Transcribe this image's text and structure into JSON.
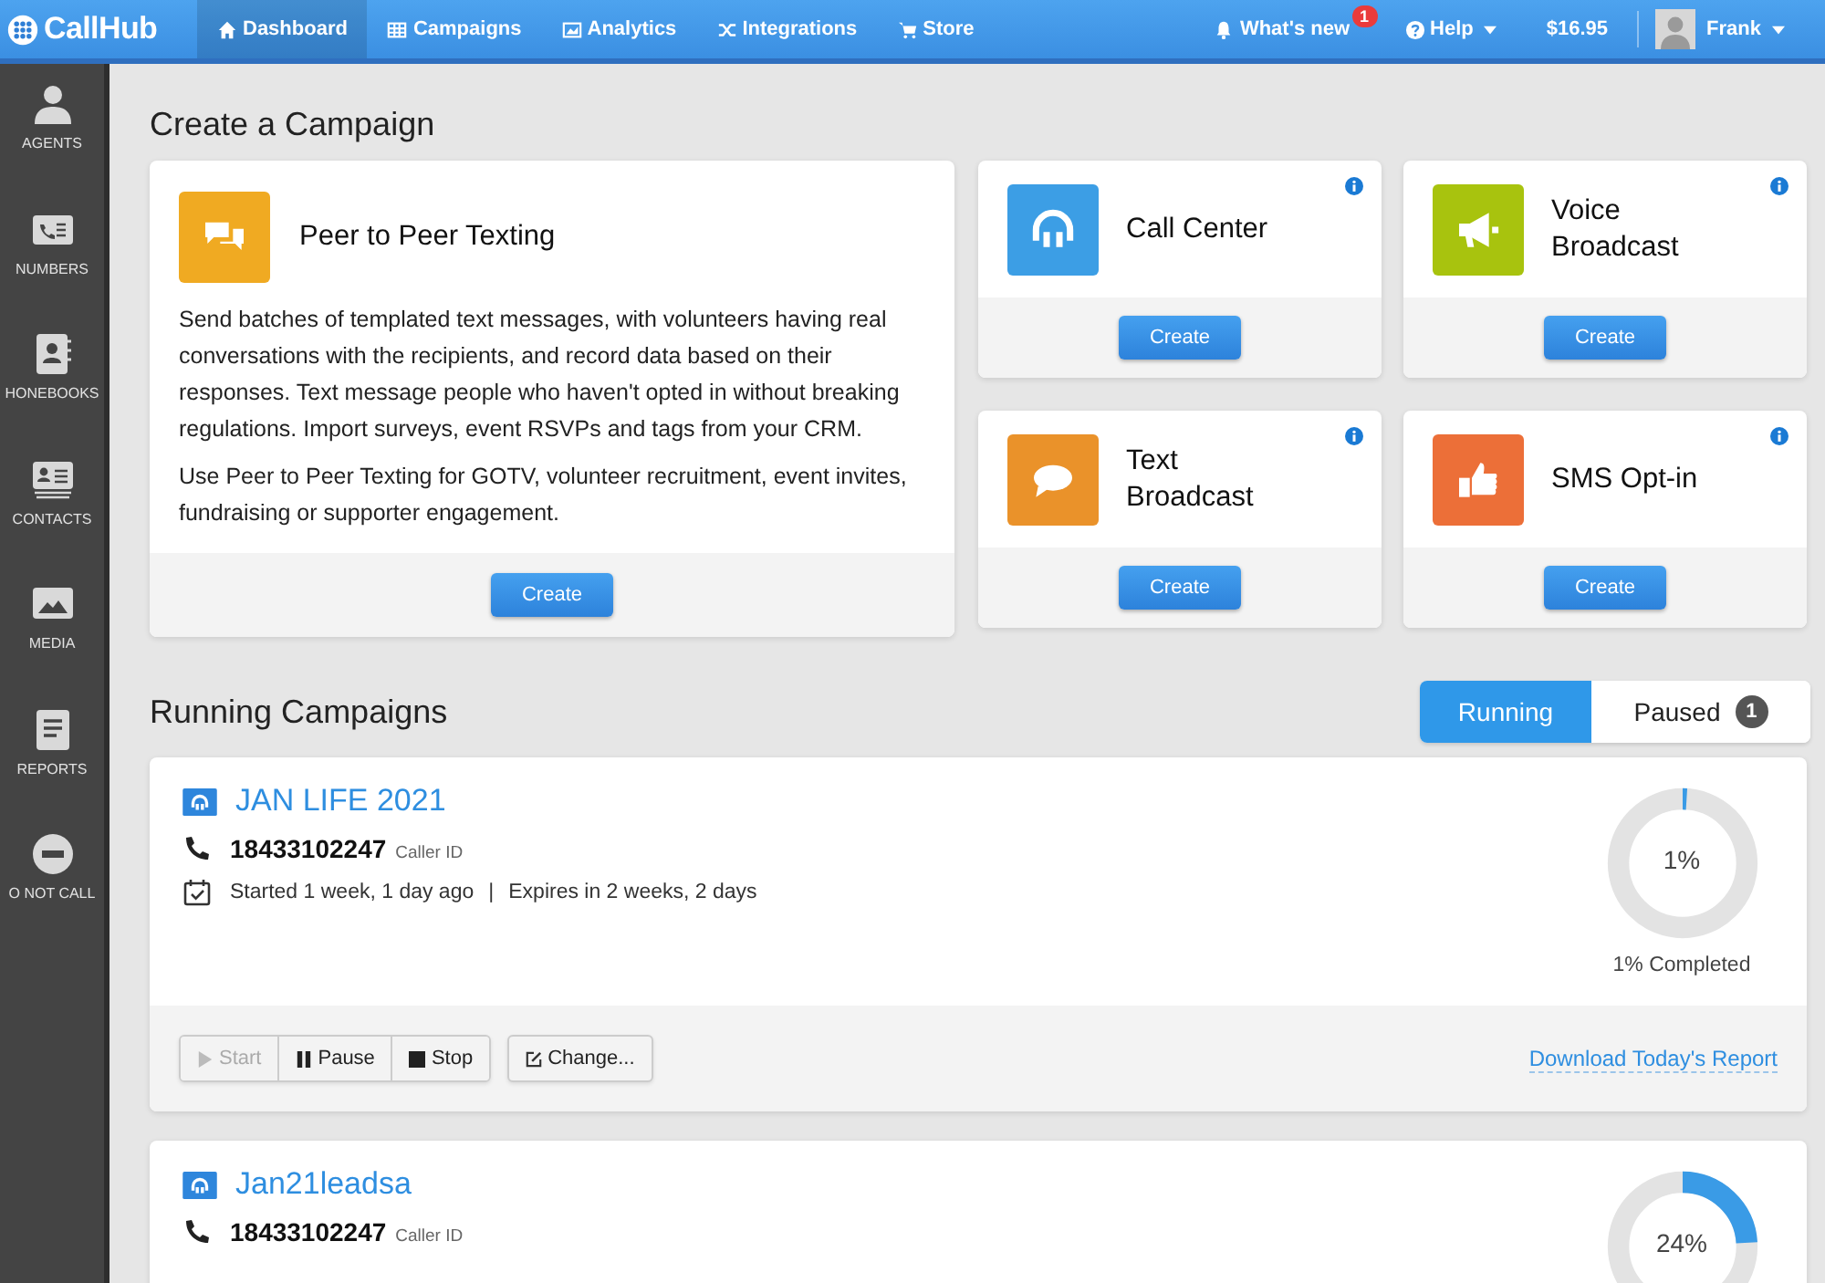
{
  "nav": {
    "logo": "CallHub",
    "items": [
      {
        "label": "Dashboard",
        "selected": true
      },
      {
        "label": "Campaigns",
        "selected": false
      },
      {
        "label": "Analytics",
        "selected": false
      },
      {
        "label": "Integrations",
        "selected": false
      },
      {
        "label": "Store",
        "selected": false
      }
    ],
    "whats_new": {
      "label": "What's new",
      "badge": "1"
    },
    "help": "Help",
    "balance": "$16.95",
    "user": "Frank"
  },
  "sidebar": {
    "items": [
      {
        "label": "AGENTS"
      },
      {
        "label": "NUMBERS"
      },
      {
        "label": "HONEBOOKS"
      },
      {
        "label": "CONTACTS"
      },
      {
        "label": "MEDIA"
      },
      {
        "label": "REPORTS"
      },
      {
        "label": "O NOT CALL"
      }
    ]
  },
  "create": {
    "title": "Create a Campaign",
    "featured": {
      "title": "Peer to Peer Texting",
      "color": "#f0aa22",
      "paragraphs": [
        "Send batches of templated text messages, with volunteers having real conversations with the recipients, and record data based on their responses. Text message people who haven't opted in without breaking regulations. Import surveys, event RSVPs and tags from your CRM.",
        "Use Peer to Peer Texting for GOTV, volunteer recruitment, event invites, fundraising or supporter engagement."
      ],
      "button": "Create"
    },
    "cards": [
      {
        "title": "Call Center",
        "color": "#3c9ee5",
        "button": "Create"
      },
      {
        "title": "Voice Broadcast",
        "color": "#a8c30e",
        "button": "Create"
      },
      {
        "title": "Text Broadcast",
        "color": "#ea922a",
        "button": "Create"
      },
      {
        "title": "SMS Opt-in",
        "color": "#ec6f38",
        "button": "Create"
      }
    ]
  },
  "running": {
    "title": "Running Campaigns",
    "filters": [
      {
        "label": "Running",
        "selected": true
      },
      {
        "label": "Paused",
        "selected": false,
        "badge": "1"
      }
    ],
    "campaigns": [
      {
        "name": "JAN LIFE 2021",
        "number": "18433102247",
        "number_label": "Caller ID",
        "started": "Started 1 week, 1 day ago",
        "separator": "|",
        "expires": "Expires in 2 weeks, 2 days",
        "level": 0.01,
        "percent": "1%",
        "completed": "1% Completed",
        "actions": [
          {
            "label": "Start",
            "disabled": true
          },
          {
            "label": "Pause",
            "disabled": false
          },
          {
            "label": "Stop",
            "disabled": false
          }
        ],
        "change": "Change...",
        "report": "Download Today's Report"
      },
      {
        "name": "Jan21leadsa",
        "number": "18433102247",
        "number_label": "Caller ID",
        "level": 0.24,
        "percent": "24%"
      }
    ]
  }
}
